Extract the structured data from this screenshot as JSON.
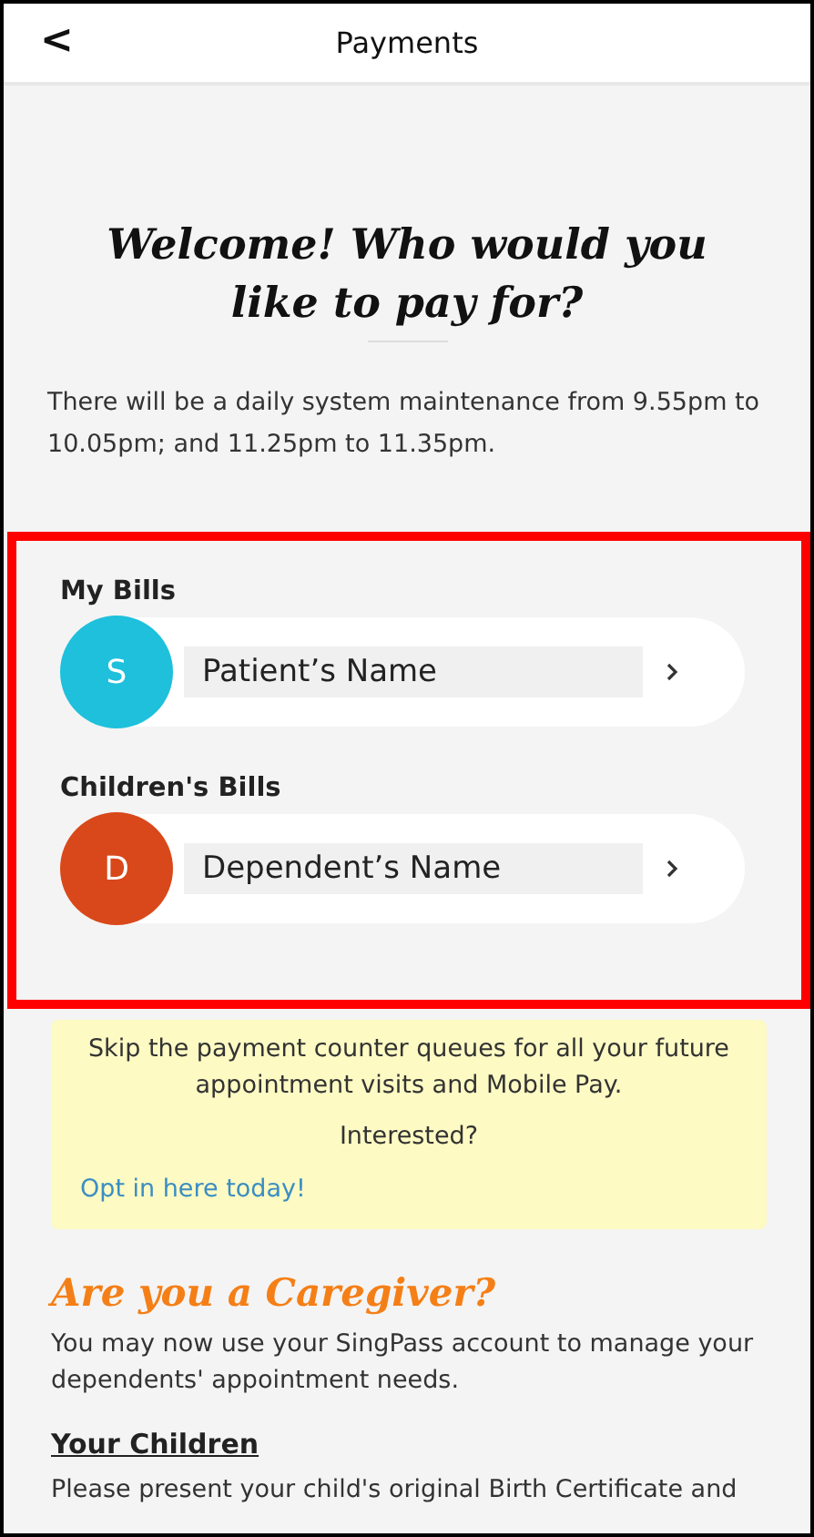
{
  "header": {
    "back_icon": "<",
    "title": "Payments"
  },
  "welcome": {
    "title": "Welcome! Who would you like to pay for?",
    "notice": "There will be a daily system maintenance from 9.55pm to 10.05pm; and 11.25pm to 11.35pm."
  },
  "bill_groups": [
    {
      "label": "My Bills",
      "person": {
        "initial": "S",
        "name": "Patient’s Name",
        "color": "#1ec0dc"
      }
    },
    {
      "label": "Children's Bills",
      "person": {
        "initial": "D",
        "name": "Dependent’s Name",
        "color": "#d9481a"
      }
    }
  ],
  "promo": {
    "text": "Skip the payment counter queues for all your future appointment visits and Mobile Pay.",
    "question": "Interested?",
    "link": "Opt in here today!"
  },
  "caregiver": {
    "title": "Are you a Caregiver?",
    "text": "You may now use your SingPass account to manage your dependents' appointment needs.",
    "subheading": "Your Children",
    "body": "Please present your child's original Birth Certificate and"
  }
}
